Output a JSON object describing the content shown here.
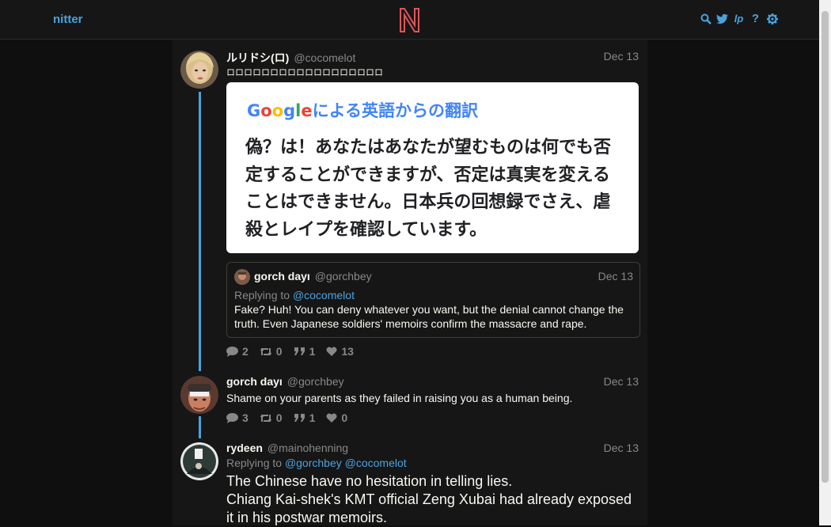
{
  "nav": {
    "brand": "nitter"
  },
  "tweets": [
    {
      "fullname": "ルリドシ(ロ)",
      "username": "@cocomelot",
      "date": "Dec 13",
      "text": "ロロロロロロロロロロロロロロロロロロ",
      "media": {
        "google_brand": "Google",
        "google_caption": "による英語からの翻訳",
        "body": "偽？は！あなたはあなたが望むものは何でも否定することができますが、否定は真実を変えることはできません。日本兵の回想録でさえ、虐殺とレイプを確認しています。"
      },
      "quote": {
        "fullname": "gorch dayı",
        "username": "@gorchbey",
        "date": "Dec 13",
        "replying_prefix": "Replying to",
        "replying_to": "@cocomelot",
        "text": "Fake? Huh! You can deny whatever you want, but the denial cannot change the truth. Even Japanese soldiers' memoirs confirm the massacre and rape."
      },
      "stats": {
        "replies": "2",
        "retweets": "0",
        "quotes": "1",
        "likes": "13"
      }
    },
    {
      "fullname": "gorch dayı",
      "username": "@gorchbey",
      "date": "Dec 13",
      "text": "Shame on your parents as they failed in raising you as a human being.",
      "stats": {
        "replies": "3",
        "retweets": "0",
        "quotes": "1",
        "likes": "0"
      }
    },
    {
      "fullname": "rydeen",
      "username": "@mainohenning",
      "date": "Dec 13",
      "replying_prefix": "Replying to",
      "replying_to": [
        "@gorchbey",
        "@cocomelot"
      ],
      "text_lines": [
        "The Chinese have no hesitation in telling lies.",
        "Chiang Kai-shek's KMT official Zeng Xubai had already exposed",
        "it in his postwar memoirs."
      ]
    }
  ],
  "colors": {
    "accent": "#4aa3df",
    "logo": "#e0555b",
    "background": "#0f0f0f",
    "panel": "#161616",
    "muted": "#888889"
  }
}
